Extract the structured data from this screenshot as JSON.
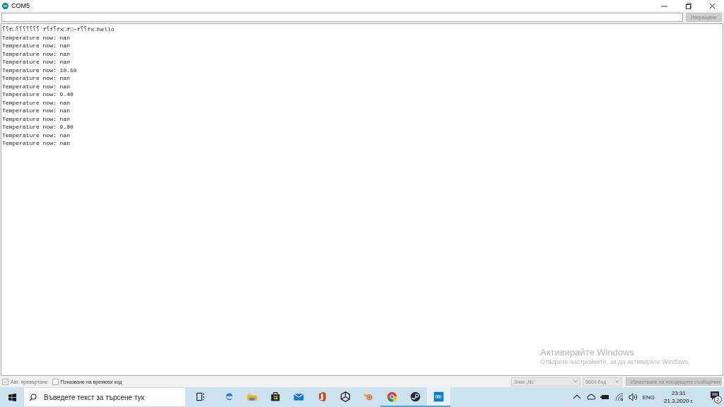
{
  "window": {
    "title": "COM5",
    "controls": [
      {
        "kind": "minimize"
      },
      {
        "kind": "restore"
      },
      {
        "kind": "close"
      }
    ]
  },
  "send_button": {
    "label": "Изпращане",
    "disabled": true
  },
  "output_lines": [
    "⸮⸮f□⸮⸮⸮⸮⸮⸮⸮`f⸮f⸮fx□f□~f⸮⸮fx□hello",
    "Temperature now: nan",
    "Temperature now: nan",
    "Temperature now: nan",
    "Temperature now: nan",
    "Temperature now: 10.50",
    "Temperature now: nan",
    "Temperature now: nan",
    "Temperature now: 9.40",
    "Temperature now: nan",
    "Temperature now: nan",
    "Temperature now: nan",
    "Temperature now: 9.80",
    "Temperature now: nan",
    "Temperature now: nan"
  ],
  "activation_notice": {
    "title": "Активирайте Windows",
    "text": "Отворете настройките, за да активирате Windows."
  },
  "bottom_bar": {
    "autoscroll": {
      "label": "Авт. превъртане",
      "checked": true,
      "disabled": true
    },
    "timestamp": {
      "label": "Показване на времеви код",
      "checked": false
    },
    "line_ending": {
      "value": "Знак „NL“",
      "disabled": true
    },
    "baud_rate": {
      "value": "9600 бод",
      "disabled": true
    },
    "clear_button": {
      "label": "Изчистване на изходящите съобщения",
      "disabled": true
    }
  },
  "taskbar": {
    "search": {
      "placeholder": "Въведете текст за търсене тук"
    },
    "apps": [
      {
        "kind": "taskview",
        "running": false,
        "selected": false
      },
      {
        "kind": "edge",
        "running": false,
        "selected": false
      },
      {
        "kind": "folder",
        "running": false,
        "selected": false
      },
      {
        "kind": "store",
        "running": false,
        "selected": false
      },
      {
        "kind": "mail",
        "running": false,
        "selected": false
      },
      {
        "kind": "office",
        "running": false,
        "selected": false
      },
      {
        "kind": "unity",
        "running": false,
        "selected": false
      },
      {
        "kind": "blender",
        "running": false,
        "selected": false
      },
      {
        "kind": "chrome",
        "running": true,
        "selected": false
      },
      {
        "kind": "steam",
        "running": true,
        "selected": false
      },
      {
        "kind": "arduino",
        "running": true,
        "selected": true
      }
    ],
    "tray": {
      "language": "ENG",
      "time": "23:31",
      "date": "21.3.2020 г.",
      "notifications": "2"
    }
  }
}
